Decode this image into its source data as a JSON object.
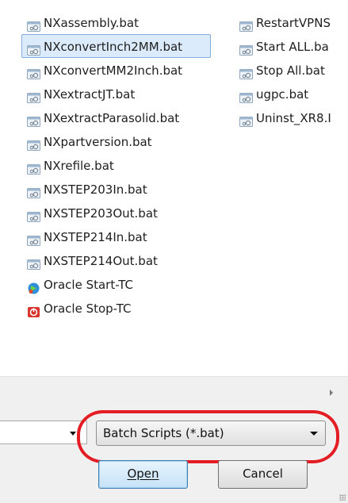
{
  "files_column1": [
    {
      "name": "NXassembly.bat",
      "icon": "batch-file-icon",
      "selected": false
    },
    {
      "name": "NXconvertInch2MM.bat",
      "icon": "batch-file-icon",
      "selected": true
    },
    {
      "name": "NXconvertMM2Inch.bat",
      "icon": "batch-file-icon",
      "selected": false
    },
    {
      "name": "NXextractJT.bat",
      "icon": "batch-file-icon",
      "selected": false
    },
    {
      "name": "NXextractParasolid.bat",
      "icon": "batch-file-icon",
      "selected": false
    },
    {
      "name": "NXpartversion.bat",
      "icon": "batch-file-icon",
      "selected": false
    },
    {
      "name": "NXrefile.bat",
      "icon": "batch-file-icon",
      "selected": false
    },
    {
      "name": "NXSTEP203In.bat",
      "icon": "batch-file-icon",
      "selected": false
    },
    {
      "name": "NXSTEP203Out.bat",
      "icon": "batch-file-icon",
      "selected": false
    },
    {
      "name": "NXSTEP214In.bat",
      "icon": "batch-file-icon",
      "selected": false
    },
    {
      "name": "NXSTEP214Out.bat",
      "icon": "batch-file-icon",
      "selected": false
    },
    {
      "name": "Oracle Start-TC",
      "icon": "oracle-start-icon",
      "selected": false
    },
    {
      "name": "Oracle Stop-TC",
      "icon": "oracle-stop-icon",
      "selected": false
    }
  ],
  "files_column2": [
    {
      "name": "RestartVPNS",
      "icon": "batch-file-icon",
      "selected": false
    },
    {
      "name": "Start ALL.ba",
      "icon": "batch-file-icon",
      "selected": false
    },
    {
      "name": "Stop All.bat",
      "icon": "batch-file-icon",
      "selected": false
    },
    {
      "name": "ugpc.bat",
      "icon": "batch-file-icon",
      "selected": false
    },
    {
      "name": "Uninst_XR8.I",
      "icon": "batch-file-icon",
      "selected": false
    }
  ],
  "filetype_select": {
    "value": "Batch Scripts (*.bat)"
  },
  "buttons": {
    "open_label": "Open",
    "cancel_label": "Cancel"
  },
  "colors": {
    "selection_bg": "#dcebfb",
    "selection_border": "#84acdd",
    "highlight_oval": "#e41d25"
  }
}
